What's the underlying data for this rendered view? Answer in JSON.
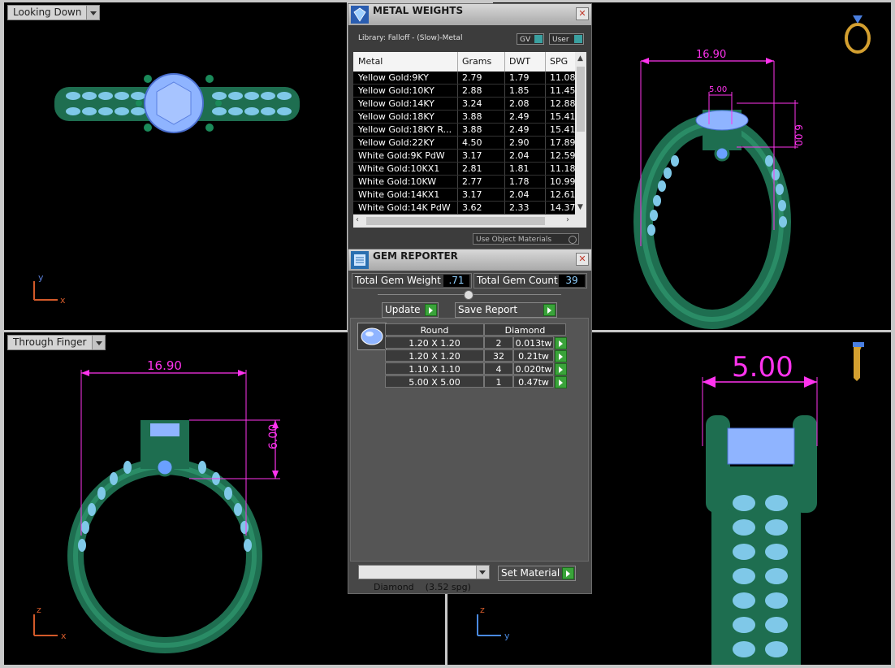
{
  "viewports": {
    "top_left_label": "Looking Down",
    "bottom_left_label": "Through Finger",
    "axes": {
      "x": "x",
      "y": "y",
      "z": "z"
    },
    "dimensions": {
      "top_right_width": "16.90",
      "top_right_stone": "5.00",
      "top_right_height": "6.00",
      "bottom_left_width": "16.90",
      "bottom_left_height": "6.00",
      "bottom_right_stone": "5.00"
    }
  },
  "metal_weights": {
    "title": "METAL WEIGHTS",
    "library": "Library: Falloff - (Slow)-Metal",
    "gv_label": "GV",
    "user_label": "User",
    "columns": [
      "Metal",
      "Grams",
      "DWT",
      "SPG"
    ],
    "rows": [
      {
        "metal": "Yellow Gold:9KY",
        "grams": "2.79",
        "dwt": "1.79",
        "spg": "11.08"
      },
      {
        "metal": "Yellow Gold:10KY",
        "grams": "2.88",
        "dwt": "1.85",
        "spg": "11.45"
      },
      {
        "metal": "Yellow Gold:14KY",
        "grams": "3.24",
        "dwt": "2.08",
        "spg": "12.88"
      },
      {
        "metal": "Yellow Gold:18KY",
        "grams": "3.88",
        "dwt": "2.49",
        "spg": "15.41"
      },
      {
        "metal": "Yellow Gold:18KY R...",
        "grams": "3.88",
        "dwt": "2.49",
        "spg": "15.41"
      },
      {
        "metal": "Yellow Gold:22KY",
        "grams": "4.50",
        "dwt": "2.90",
        "spg": "17.89"
      },
      {
        "metal": "White Gold:9K PdW",
        "grams": "3.17",
        "dwt": "2.04",
        "spg": "12.59"
      },
      {
        "metal": "White Gold:10KX1",
        "grams": "2.81",
        "dwt": "1.81",
        "spg": "11.18"
      },
      {
        "metal": "White Gold:10KW",
        "grams": "2.77",
        "dwt": "1.78",
        "spg": "10.99"
      },
      {
        "metal": "White Gold:14KX1",
        "grams": "3.17",
        "dwt": "2.04",
        "spg": "12.61"
      },
      {
        "metal": "White Gold:14K PdW",
        "grams": "3.62",
        "dwt": "2.33",
        "spg": "14.37"
      }
    ],
    "use_object_materials": "Use Object Materials"
  },
  "gem_reporter": {
    "title": "GEM REPORTER",
    "total_weight_label": "Total Gem Weight",
    "total_weight_value": ".71",
    "total_count_label": "Total Gem Count",
    "total_count_value": "39",
    "update_label": "Update",
    "save_report_label": "Save Report",
    "header_shape": "Round",
    "header_material": "Diamond",
    "rows": [
      {
        "size": "1.20 X 1.20",
        "count": "2",
        "weight": "0.013tw"
      },
      {
        "size": "1.20 X 1.20",
        "count": "32",
        "weight": "0.21tw"
      },
      {
        "size": "1.10 X 1.10",
        "count": "4",
        "weight": "0.020tw"
      },
      {
        "size": "5.00 X 5.00",
        "count": "1",
        "weight": "0.47tw"
      }
    ],
    "material_select": "Diamond    (3.52 spg)",
    "set_material_label": "Set Material"
  }
}
